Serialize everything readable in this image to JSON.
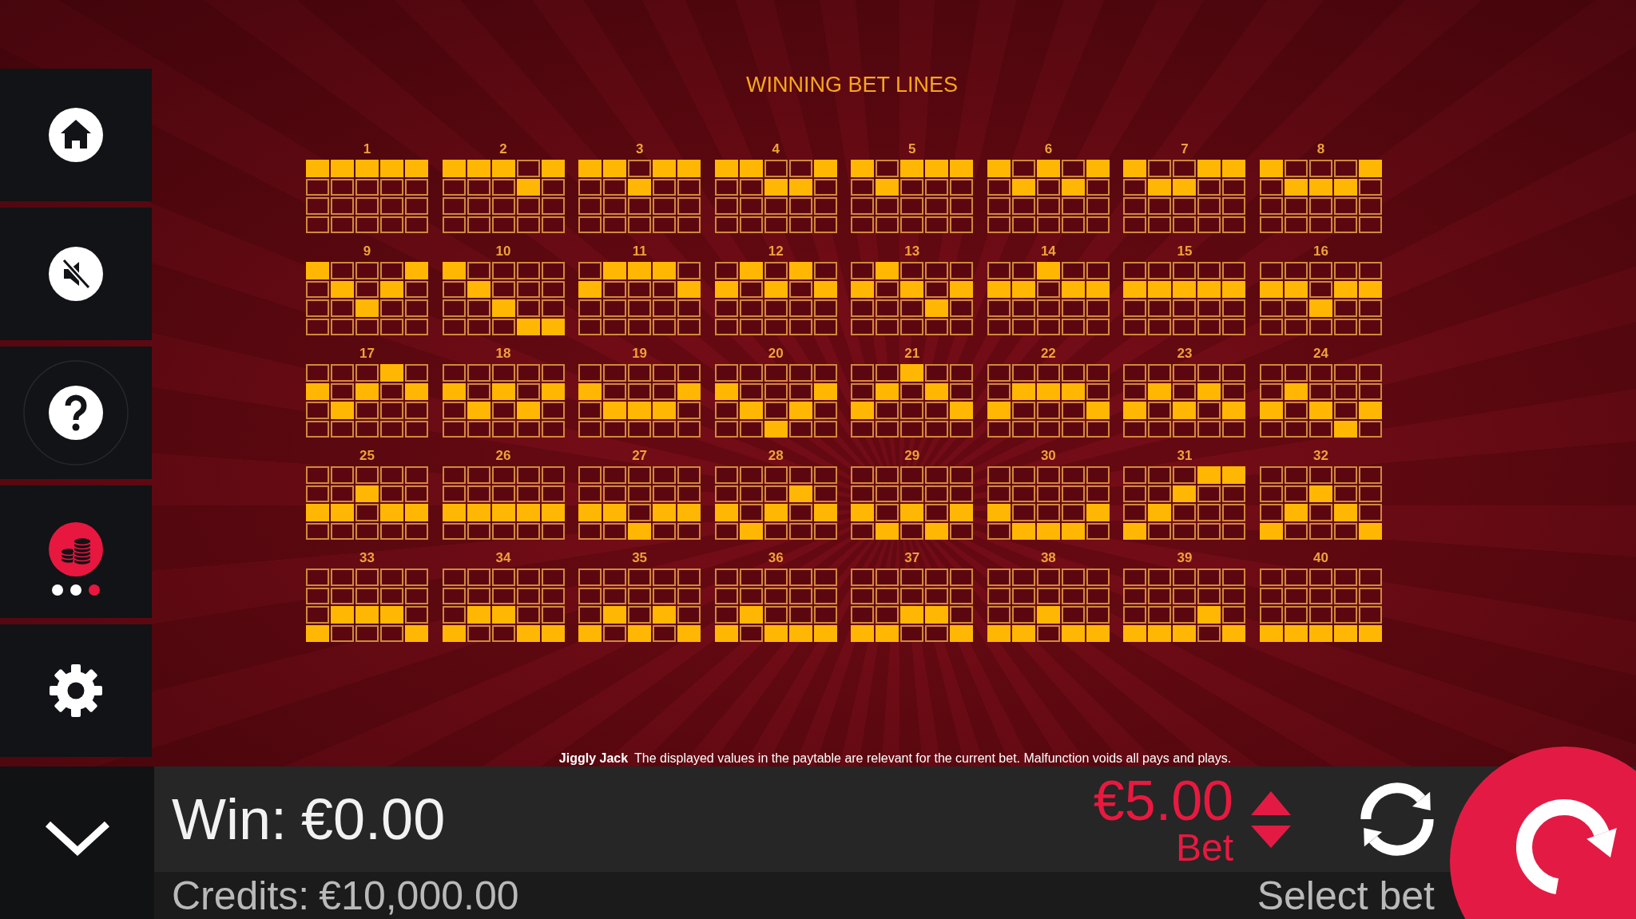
{
  "sidebar": {
    "items": [
      {
        "kind": "home",
        "selected": false
      },
      {
        "kind": "sound",
        "selected": false,
        "muted": true
      },
      {
        "kind": "help",
        "selected": false
      },
      {
        "kind": "bet",
        "selected": true,
        "dots": [
          {
            "selected": false
          },
          {
            "selected": false
          },
          {
            "selected": true
          }
        ]
      },
      {
        "kind": "settings",
        "selected": false
      }
    ]
  },
  "title": "WINNING BET LINES",
  "bet_lines": [
    {
      "number": "1",
      "cells": [
        [
          true,
          true,
          true,
          true,
          true
        ],
        [
          false,
          false,
          false,
          false,
          false
        ],
        [
          false,
          false,
          false,
          false,
          false
        ],
        [
          false,
          false,
          false,
          false,
          false
        ]
      ]
    },
    {
      "number": "2",
      "cells": [
        [
          true,
          true,
          true,
          false,
          true
        ],
        [
          false,
          false,
          false,
          true,
          false
        ],
        [
          false,
          false,
          false,
          false,
          false
        ],
        [
          false,
          false,
          false,
          false,
          false
        ]
      ]
    },
    {
      "number": "3",
      "cells": [
        [
          true,
          true,
          false,
          true,
          true
        ],
        [
          false,
          false,
          true,
          false,
          false
        ],
        [
          false,
          false,
          false,
          false,
          false
        ],
        [
          false,
          false,
          false,
          false,
          false
        ]
      ]
    },
    {
      "number": "4",
      "cells": [
        [
          true,
          true,
          false,
          false,
          true
        ],
        [
          false,
          false,
          true,
          true,
          false
        ],
        [
          false,
          false,
          false,
          false,
          false
        ],
        [
          false,
          false,
          false,
          false,
          false
        ]
      ]
    },
    {
      "number": "5",
      "cells": [
        [
          true,
          false,
          true,
          true,
          true
        ],
        [
          false,
          true,
          false,
          false,
          false
        ],
        [
          false,
          false,
          false,
          false,
          false
        ],
        [
          false,
          false,
          false,
          false,
          false
        ]
      ]
    },
    {
      "number": "6",
      "cells": [
        [
          true,
          false,
          true,
          false,
          true
        ],
        [
          false,
          true,
          false,
          true,
          false
        ],
        [
          false,
          false,
          false,
          false,
          false
        ],
        [
          false,
          false,
          false,
          false,
          false
        ]
      ]
    },
    {
      "number": "7",
      "cells": [
        [
          true,
          false,
          false,
          true,
          true
        ],
        [
          false,
          true,
          true,
          false,
          false
        ],
        [
          false,
          false,
          false,
          false,
          false
        ],
        [
          false,
          false,
          false,
          false,
          false
        ]
      ]
    },
    {
      "number": "8",
      "cells": [
        [
          true,
          false,
          false,
          false,
          true
        ],
        [
          false,
          true,
          true,
          true,
          false
        ],
        [
          false,
          false,
          false,
          false,
          false
        ],
        [
          false,
          false,
          false,
          false,
          false
        ]
      ]
    },
    {
      "number": "9",
      "cells": [
        [
          true,
          false,
          false,
          false,
          true
        ],
        [
          false,
          true,
          false,
          true,
          false
        ],
        [
          false,
          false,
          true,
          false,
          false
        ],
        [
          false,
          false,
          false,
          false,
          false
        ]
      ]
    },
    {
      "number": "10",
      "cells": [
        [
          true,
          false,
          false,
          false,
          false
        ],
        [
          false,
          true,
          false,
          false,
          false
        ],
        [
          false,
          false,
          true,
          false,
          false
        ],
        [
          false,
          false,
          false,
          true,
          true
        ]
      ]
    },
    {
      "number": "11",
      "cells": [
        [
          false,
          true,
          true,
          true,
          false
        ],
        [
          true,
          false,
          false,
          false,
          true
        ],
        [
          false,
          false,
          false,
          false,
          false
        ],
        [
          false,
          false,
          false,
          false,
          false
        ]
      ]
    },
    {
      "number": "12",
      "cells": [
        [
          false,
          true,
          false,
          true,
          false
        ],
        [
          true,
          false,
          true,
          false,
          true
        ],
        [
          false,
          false,
          false,
          false,
          false
        ],
        [
          false,
          false,
          false,
          false,
          false
        ]
      ]
    },
    {
      "number": "13",
      "cells": [
        [
          false,
          true,
          false,
          false,
          false
        ],
        [
          true,
          false,
          true,
          false,
          true
        ],
        [
          false,
          false,
          false,
          true,
          false
        ],
        [
          false,
          false,
          false,
          false,
          false
        ]
      ]
    },
    {
      "number": "14",
      "cells": [
        [
          false,
          false,
          true,
          false,
          false
        ],
        [
          true,
          true,
          false,
          true,
          true
        ],
        [
          false,
          false,
          false,
          false,
          false
        ],
        [
          false,
          false,
          false,
          false,
          false
        ]
      ]
    },
    {
      "number": "15",
      "cells": [
        [
          false,
          false,
          false,
          false,
          false
        ],
        [
          true,
          true,
          true,
          true,
          true
        ],
        [
          false,
          false,
          false,
          false,
          false
        ],
        [
          false,
          false,
          false,
          false,
          false
        ]
      ]
    },
    {
      "number": "16",
      "cells": [
        [
          false,
          false,
          false,
          false,
          false
        ],
        [
          true,
          true,
          false,
          true,
          true
        ],
        [
          false,
          false,
          true,
          false,
          false
        ],
        [
          false,
          false,
          false,
          false,
          false
        ]
      ]
    },
    {
      "number": "17",
      "cells": [
        [
          false,
          false,
          false,
          true,
          false
        ],
        [
          true,
          false,
          true,
          false,
          true
        ],
        [
          false,
          true,
          false,
          false,
          false
        ],
        [
          false,
          false,
          false,
          false,
          false
        ]
      ]
    },
    {
      "number": "18",
      "cells": [
        [
          false,
          false,
          false,
          false,
          false
        ],
        [
          true,
          false,
          true,
          false,
          true
        ],
        [
          false,
          true,
          false,
          true,
          false
        ],
        [
          false,
          false,
          false,
          false,
          false
        ]
      ]
    },
    {
      "number": "19",
      "cells": [
        [
          false,
          false,
          false,
          false,
          false
        ],
        [
          true,
          false,
          false,
          false,
          true
        ],
        [
          false,
          true,
          true,
          true,
          false
        ],
        [
          false,
          false,
          false,
          false,
          false
        ]
      ]
    },
    {
      "number": "20",
      "cells": [
        [
          false,
          false,
          false,
          false,
          false
        ],
        [
          true,
          false,
          false,
          false,
          true
        ],
        [
          false,
          true,
          false,
          true,
          false
        ],
        [
          false,
          false,
          true,
          false,
          false
        ]
      ]
    },
    {
      "number": "21",
      "cells": [
        [
          false,
          false,
          true,
          false,
          false
        ],
        [
          false,
          true,
          false,
          true,
          false
        ],
        [
          true,
          false,
          false,
          false,
          true
        ],
        [
          false,
          false,
          false,
          false,
          false
        ]
      ]
    },
    {
      "number": "22",
      "cells": [
        [
          false,
          false,
          false,
          false,
          false
        ],
        [
          false,
          true,
          true,
          true,
          false
        ],
        [
          true,
          false,
          false,
          false,
          true
        ],
        [
          false,
          false,
          false,
          false,
          false
        ]
      ]
    },
    {
      "number": "23",
      "cells": [
        [
          false,
          false,
          false,
          false,
          false
        ],
        [
          false,
          true,
          false,
          true,
          false
        ],
        [
          true,
          false,
          true,
          false,
          true
        ],
        [
          false,
          false,
          false,
          false,
          false
        ]
      ]
    },
    {
      "number": "24",
      "cells": [
        [
          false,
          false,
          false,
          false,
          false
        ],
        [
          false,
          true,
          false,
          false,
          false
        ],
        [
          true,
          false,
          true,
          false,
          true
        ],
        [
          false,
          false,
          false,
          true,
          false
        ]
      ]
    },
    {
      "number": "25",
      "cells": [
        [
          false,
          false,
          false,
          false,
          false
        ],
        [
          false,
          false,
          true,
          false,
          false
        ],
        [
          true,
          true,
          false,
          true,
          true
        ],
        [
          false,
          false,
          false,
          false,
          false
        ]
      ]
    },
    {
      "number": "26",
      "cells": [
        [
          false,
          false,
          false,
          false,
          false
        ],
        [
          false,
          false,
          false,
          false,
          false
        ],
        [
          true,
          true,
          true,
          true,
          true
        ],
        [
          false,
          false,
          false,
          false,
          false
        ]
      ]
    },
    {
      "number": "27",
      "cells": [
        [
          false,
          false,
          false,
          false,
          false
        ],
        [
          false,
          false,
          false,
          false,
          false
        ],
        [
          true,
          true,
          false,
          true,
          true
        ],
        [
          false,
          false,
          true,
          false,
          false
        ]
      ]
    },
    {
      "number": "28",
      "cells": [
        [
          false,
          false,
          false,
          false,
          false
        ],
        [
          false,
          false,
          false,
          true,
          false
        ],
        [
          true,
          false,
          true,
          false,
          true
        ],
        [
          false,
          true,
          false,
          false,
          false
        ]
      ]
    },
    {
      "number": "29",
      "cells": [
        [
          false,
          false,
          false,
          false,
          false
        ],
        [
          false,
          false,
          false,
          false,
          false
        ],
        [
          true,
          false,
          true,
          false,
          true
        ],
        [
          false,
          true,
          false,
          true,
          false
        ]
      ]
    },
    {
      "number": "30",
      "cells": [
        [
          false,
          false,
          false,
          false,
          false
        ],
        [
          false,
          false,
          false,
          false,
          false
        ],
        [
          true,
          false,
          false,
          false,
          true
        ],
        [
          false,
          true,
          true,
          true,
          false
        ]
      ]
    },
    {
      "number": "31",
      "cells": [
        [
          false,
          false,
          false,
          true,
          true
        ],
        [
          false,
          false,
          true,
          false,
          false
        ],
        [
          false,
          true,
          false,
          false,
          false
        ],
        [
          true,
          false,
          false,
          false,
          false
        ]
      ]
    },
    {
      "number": "32",
      "cells": [
        [
          false,
          false,
          false,
          false,
          false
        ],
        [
          false,
          false,
          true,
          false,
          false
        ],
        [
          false,
          true,
          false,
          true,
          false
        ],
        [
          true,
          false,
          false,
          false,
          true
        ]
      ]
    },
    {
      "number": "33",
      "cells": [
        [
          false,
          false,
          false,
          false,
          false
        ],
        [
          false,
          false,
          false,
          false,
          false
        ],
        [
          false,
          true,
          true,
          true,
          false
        ],
        [
          true,
          false,
          false,
          false,
          true
        ]
      ]
    },
    {
      "number": "34",
      "cells": [
        [
          false,
          false,
          false,
          false,
          false
        ],
        [
          false,
          false,
          false,
          false,
          false
        ],
        [
          false,
          true,
          true,
          false,
          false
        ],
        [
          true,
          false,
          false,
          true,
          true
        ]
      ]
    },
    {
      "number": "35",
      "cells": [
        [
          false,
          false,
          false,
          false,
          false
        ],
        [
          false,
          false,
          false,
          false,
          false
        ],
        [
          false,
          true,
          false,
          true,
          false
        ],
        [
          true,
          false,
          true,
          false,
          true
        ]
      ]
    },
    {
      "number": "36",
      "cells": [
        [
          false,
          false,
          false,
          false,
          false
        ],
        [
          false,
          false,
          false,
          false,
          false
        ],
        [
          false,
          true,
          false,
          false,
          false
        ],
        [
          true,
          false,
          true,
          true,
          true
        ]
      ]
    },
    {
      "number": "37",
      "cells": [
        [
          false,
          false,
          false,
          false,
          false
        ],
        [
          false,
          false,
          false,
          false,
          false
        ],
        [
          false,
          false,
          true,
          true,
          false
        ],
        [
          true,
          true,
          false,
          false,
          true
        ]
      ]
    },
    {
      "number": "38",
      "cells": [
        [
          false,
          false,
          false,
          false,
          false
        ],
        [
          false,
          false,
          false,
          false,
          false
        ],
        [
          false,
          false,
          true,
          false,
          false
        ],
        [
          true,
          true,
          false,
          true,
          true
        ]
      ]
    },
    {
      "number": "39",
      "cells": [
        [
          false,
          false,
          false,
          false,
          false
        ],
        [
          false,
          false,
          false,
          false,
          false
        ],
        [
          false,
          false,
          false,
          true,
          false
        ],
        [
          true,
          true,
          true,
          false,
          true
        ]
      ]
    },
    {
      "number": "40",
      "cells": [
        [
          false,
          false,
          false,
          false,
          false
        ],
        [
          false,
          false,
          false,
          false,
          false
        ],
        [
          false,
          false,
          false,
          false,
          false
        ],
        [
          true,
          true,
          true,
          true,
          true
        ]
      ]
    }
  ],
  "footer": {
    "game_name": "Jiggly Jack",
    "disclaimer": "The displayed values in the paytable are relevant for the current bet. Malfunction voids all pays and plays."
  },
  "bottom_bar": {
    "win_label": "Win:",
    "win_value": "€0.00",
    "bet_value": "€5.00",
    "bet_label": "Bet",
    "credits_label": "Credits:",
    "credits_value": "€10,000.00",
    "select_bet": "Select bet"
  }
}
